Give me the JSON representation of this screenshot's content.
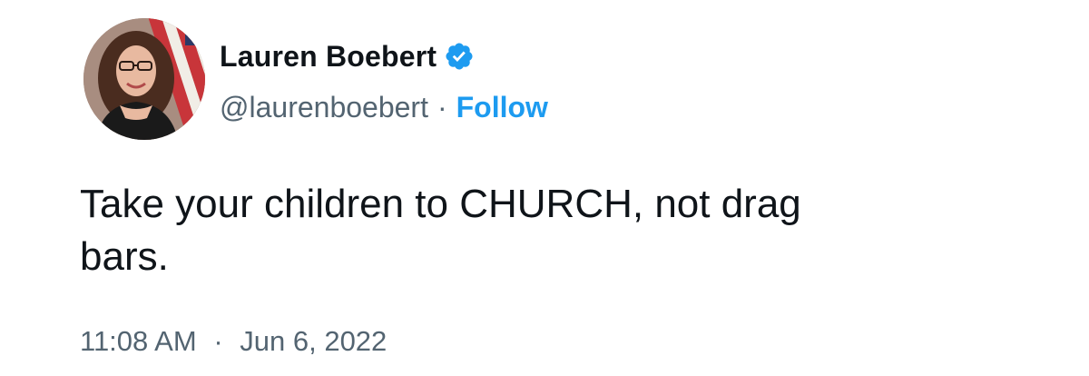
{
  "tweet": {
    "author_name": "Lauren Boebert",
    "author_handle": "@laurenboebert",
    "separator": "·",
    "follow_label": "Follow",
    "text": "Take your children to CHURCH, not drag\nbars.",
    "time": "11:08 AM",
    "date": "Jun 6, 2022",
    "verified": true
  },
  "icons": {
    "verified": "verified-badge-icon",
    "avatar": "profile-avatar"
  },
  "colors": {
    "text_primary": "#0f1419",
    "text_secondary": "#536471",
    "accent_blue": "#1d9bf0"
  }
}
